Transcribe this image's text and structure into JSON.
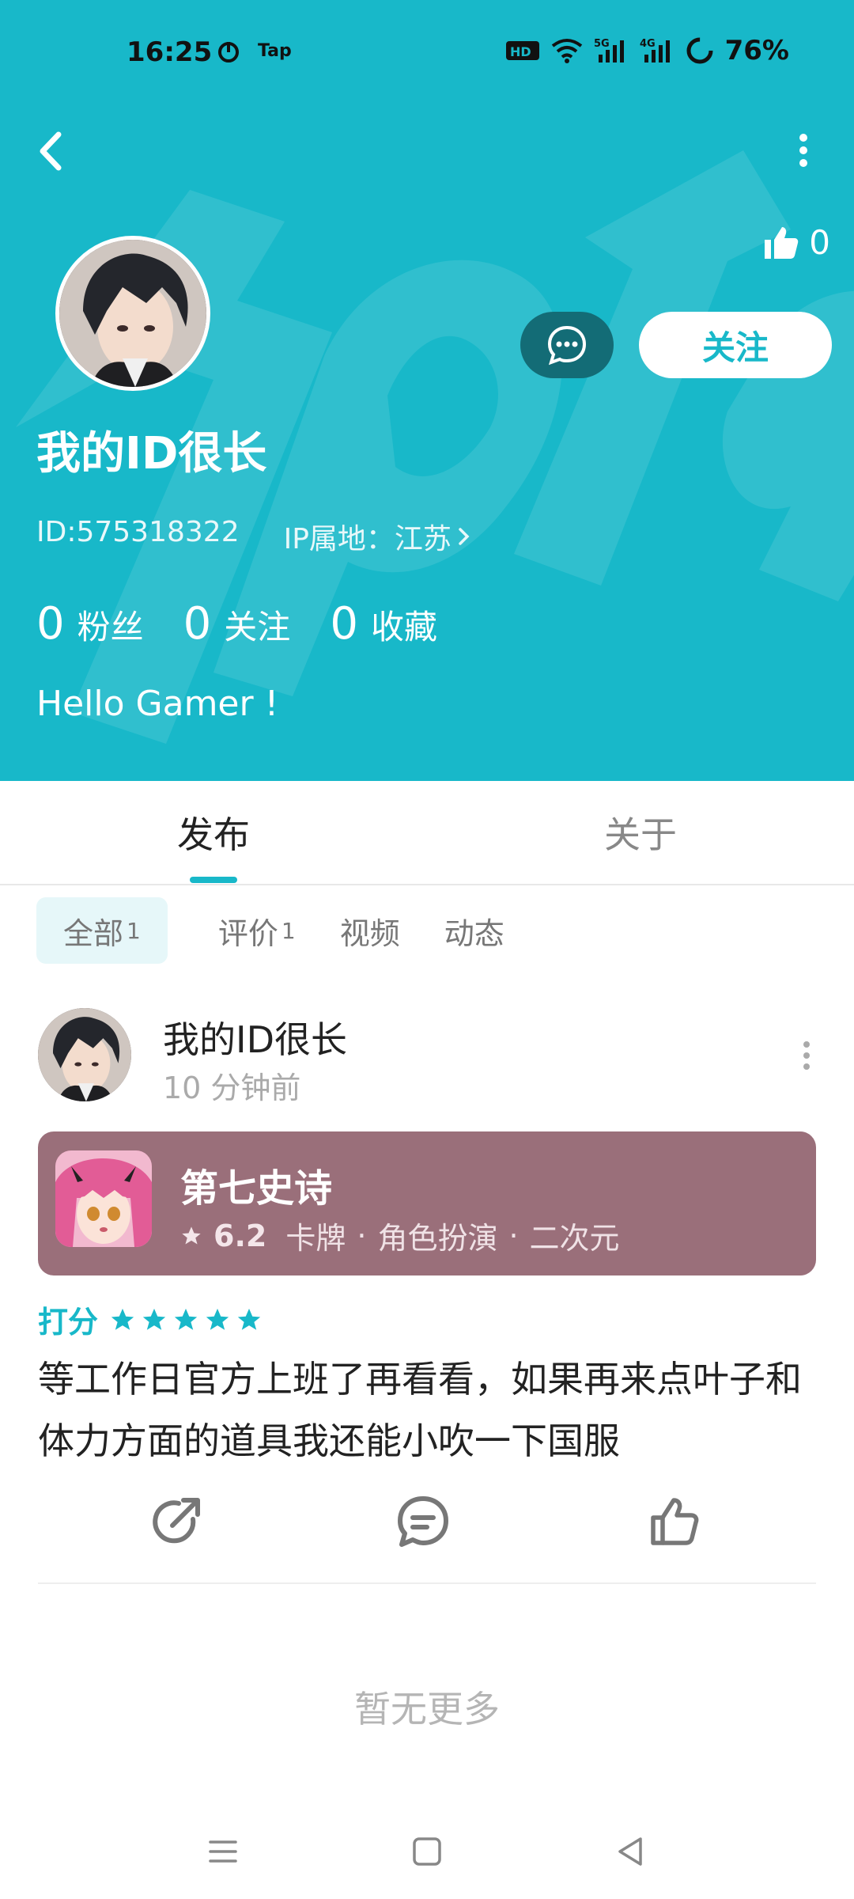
{
  "status_bar": {
    "time": "16:25",
    "app_badge": "Tap",
    "battery": "76%",
    "icons": [
      "hd-voice-icon",
      "wifi-icon",
      "5g-signal-icon",
      "4g-signal-icon",
      "battery-icon"
    ]
  },
  "profile": {
    "name": "我的ID很长",
    "id": "ID:575318322",
    "ip_location": "IP属地：江苏",
    "likes": "0",
    "follow_label": "关注",
    "bio": "Hello Gamer !",
    "stats": [
      {
        "num": "0",
        "label": "粉丝"
      },
      {
        "num": "0",
        "label": "关注"
      },
      {
        "num": "0",
        "label": "收藏"
      }
    ]
  },
  "tabs": {
    "publish": "发布",
    "about": "关于"
  },
  "filters": [
    {
      "label": "全部",
      "count": "1"
    },
    {
      "label": "评价",
      "count": "1"
    },
    {
      "label": "视频",
      "count": ""
    },
    {
      "label": "动态",
      "count": ""
    }
  ],
  "post": {
    "author": "我的ID很长",
    "time": "10 分钟前",
    "game": {
      "name": "第七史诗",
      "rating": "6.2",
      "tags": [
        "卡牌",
        "角色扮演",
        "二次元"
      ],
      "separator": "·"
    },
    "score_label": "打分",
    "stars": 5,
    "text": "等工作日官方上班了再看看，如果再来点叶子和体力方面的道具我还能小吹一下国服"
  },
  "footer": {
    "no_more": "暂无更多"
  },
  "colors": {
    "accent": "#18b8c9",
    "header_bg": "#18b8c9",
    "game_card_bg": "#9a6f7a"
  }
}
